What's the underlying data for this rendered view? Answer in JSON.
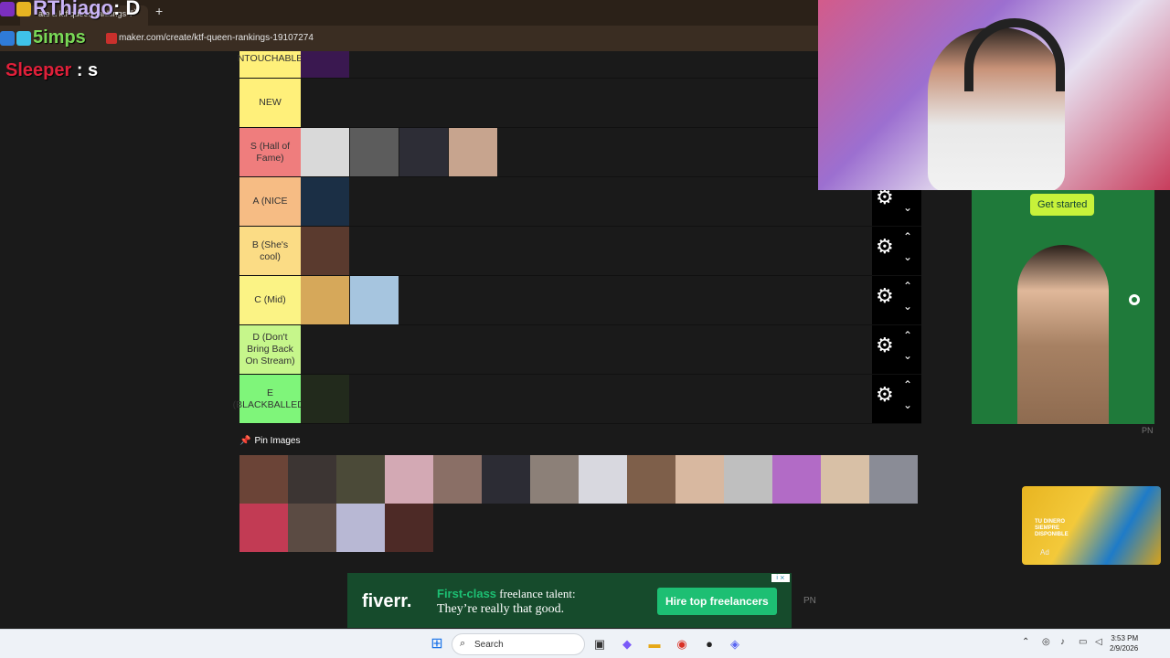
{
  "browser": {
    "tab_title": "ate a ktf queen rankings T",
    "tab_close": "×",
    "new_tab": "+",
    "url": "maker.com/create/ktf-queen-rankings-19107274"
  },
  "chat": [
    {
      "user": "RThiago",
      "message": ": D",
      "user_color": "#c9b3f5"
    },
    {
      "user": "5imps",
      "message": "",
      "user_color": "#7ad957"
    },
    {
      "user": "Sleeper",
      "message": ": s",
      "user_color": "#e0203a"
    }
  ],
  "tiers": [
    {
      "label": "NTOUCHABLE",
      "color": "#fff07a",
      "items": [
        "#3a1850"
      ],
      "controls": false
    },
    {
      "label": "NEW",
      "color": "#fff07a",
      "items": [],
      "controls": false
    },
    {
      "label": "S (Hall of Fame)",
      "color": "#ef7d7d",
      "items": [
        "#d9d9d9",
        "#5c5c5c",
        "#2d2d36",
        "#c7a48e"
      ],
      "controls": false
    },
    {
      "label": "A (NICE",
      "color": "#f6bc84",
      "items": [
        "#1b2f45"
      ],
      "controls": true
    },
    {
      "label": "B (She's cool)",
      "color": "#fbdc85",
      "items": [
        "#5a3a2e"
      ],
      "controls": true
    },
    {
      "label": "C (Mid)",
      "color": "#fbf385",
      "items": [
        "#d6a85a",
        "#a6c5df"
      ],
      "controls": true
    },
    {
      "label": "D (Don't Bring Back On Stream)",
      "color": "#c6f68b",
      "items": [],
      "controls": true
    },
    {
      "label": "E (BLACKBALLED)",
      "color": "#7ff57a",
      "items": [
        "#222a1c"
      ],
      "controls": true
    }
  ],
  "controls": {
    "gear_icon": "gear-icon",
    "up_icon": "chevron-up-icon",
    "down_icon": "chevron-down-icon"
  },
  "pool": {
    "title": "Pin Images",
    "items": [
      "#6b4437",
      "#3c3533",
      "#4b4a38",
      "#d3a9b4",
      "#8a6f66",
      "#2c2c34",
      "#8c8078",
      "#d8d8df",
      "#7e5f4a",
      "#d8b8a0",
      "#bfbfbf",
      "#b26bc6",
      "#d8c0a6",
      "#8a8c96",
      "#c23b54",
      "#5b4b43",
      "#b8b8d4",
      "#4d2a26"
    ]
  },
  "side_ad": {
    "cta": "Get started",
    "pn": "PN"
  },
  "video_ad": {
    "text": "TU DINERO SIEMPRE DISPONIBLE",
    "label": "Ad"
  },
  "bottom_ad": {
    "logo": "fiverr.",
    "line1_highlight": "First-class",
    "line1_rest": " freelance talent:",
    "line2": "They’re really that good.",
    "button": "Hire top freelancers",
    "pn": "PN",
    "choices": "i ⨯"
  },
  "taskbar": {
    "search_placeholder": "Search",
    "time": "3:53 PM",
    "date": "2/9/2026"
  }
}
